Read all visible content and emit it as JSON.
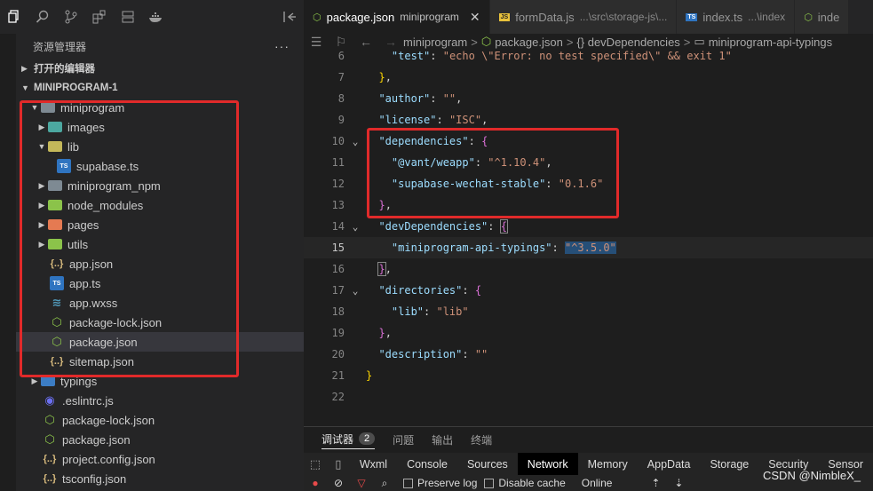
{
  "left_toolbar": {
    "icons": [
      "explorer-icon",
      "search-icon",
      "source-control-icon",
      "extensions-icon",
      "stack-icon",
      "docker-icon",
      "collapse-icon"
    ]
  },
  "explorer": {
    "title": "资源管理器",
    "more": "···",
    "open_editors_label": "打开的编辑器",
    "project_label": "MINIPROGRAM-1",
    "tree": [
      {
        "label": "miniprogram",
        "kind": "folder",
        "icon": "folder-icon"
      },
      {
        "label": "images",
        "kind": "folder",
        "icon": "folder-images-icon"
      },
      {
        "label": "lib",
        "kind": "folder",
        "icon": "folder-lib-icon"
      },
      {
        "label": "supabase.ts",
        "kind": "file",
        "icon": "ts-icon"
      },
      {
        "label": "miniprogram_npm",
        "kind": "folder",
        "icon": "folder-icon"
      },
      {
        "label": "node_modules",
        "kind": "folder",
        "icon": "folder-node-icon"
      },
      {
        "label": "pages",
        "kind": "folder",
        "icon": "folder-pages-icon"
      },
      {
        "label": "utils",
        "kind": "folder",
        "icon": "folder-utils-icon"
      },
      {
        "label": "app.json",
        "kind": "file",
        "icon": "json-icon"
      },
      {
        "label": "app.ts",
        "kind": "file",
        "icon": "ts-icon"
      },
      {
        "label": "app.wxss",
        "kind": "file",
        "icon": "wxss-icon"
      },
      {
        "label": "package-lock.json",
        "kind": "file",
        "icon": "node-icon"
      },
      {
        "label": "package.json",
        "kind": "file",
        "icon": "node-icon"
      },
      {
        "label": "sitemap.json",
        "kind": "file",
        "icon": "json-icon"
      },
      {
        "label": "typings",
        "kind": "folder",
        "icon": "folder-ts-icon"
      },
      {
        "label": ".eslintrc.js",
        "kind": "file",
        "icon": "eslint-icon"
      },
      {
        "label": "package-lock.json",
        "kind": "file",
        "icon": "node-icon"
      },
      {
        "label": "package.json",
        "kind": "file",
        "icon": "node-icon"
      },
      {
        "label": "project.config.json",
        "kind": "file",
        "icon": "json-icon"
      },
      {
        "label": "tsconfig.json",
        "kind": "file",
        "icon": "json-icon"
      }
    ]
  },
  "tabs": [
    {
      "label": "package.json",
      "desc": "miniprogram",
      "icon": "node-icon",
      "close": "✕"
    },
    {
      "label": "formData.js",
      "desc": "...\\src\\storage-js\\...",
      "icon": "js-icon"
    },
    {
      "label": "index.ts",
      "desc": "...\\index",
      "icon": "ts-icon"
    },
    {
      "label": "inde",
      "desc": "",
      "icon": "node-icon"
    }
  ],
  "breadcrumb": {
    "items": [
      "miniprogram",
      "package.json",
      "{} devDependencies",
      "miniprogram-api-typings"
    ],
    "separator": ">"
  },
  "code": {
    "line_numbers": [
      "6",
      "7",
      "8",
      "9",
      "10",
      "11",
      "12",
      "13",
      "14",
      "15",
      "16",
      "17",
      "18",
      "19",
      "20",
      "21",
      "22"
    ],
    "test_key": "\"test\"",
    "test_val": "\"echo \\\"Error: no test specified\\\" && exit 1\"",
    "author_key": "\"author\"",
    "author_val": "\"\"",
    "license_key": "\"license\"",
    "license_val": "\"ISC\"",
    "deps_key": "\"dependencies\"",
    "vant_key": "\"@vant/weapp\"",
    "vant_val": "\"^1.10.4\"",
    "supa_key": "\"supabase-wechat-stable\"",
    "supa_val": "\"0.1.6\"",
    "devdeps_key": "\"devDependencies\"",
    "typings_key": "\"miniprogram-api-typings\"",
    "typings_val": "\"^3.5.0\"",
    "dirs_key": "\"directories\"",
    "lib_key": "\"lib\"",
    "lib_val": "\"lib\"",
    "desc_key": "\"description\"",
    "desc_val": "\"\""
  },
  "panel": {
    "tabs": [
      "调试器",
      "问题",
      "输出",
      "终端"
    ],
    "debugger_badge": "2"
  },
  "devtools": {
    "tabs": [
      "Wxml",
      "Console",
      "Sources",
      "Network",
      "Memory",
      "AppData",
      "Storage",
      "Security",
      "Sensor"
    ],
    "preserve_log": "Preserve log",
    "disable_cache": "Disable cache",
    "throttle": "Online"
  },
  "watermark": "CSDN @NimbleX_",
  "colors": {
    "highlight_box": "#e12a2a",
    "selected_row": "#37373d",
    "active_devtools_tab": "#000000"
  }
}
